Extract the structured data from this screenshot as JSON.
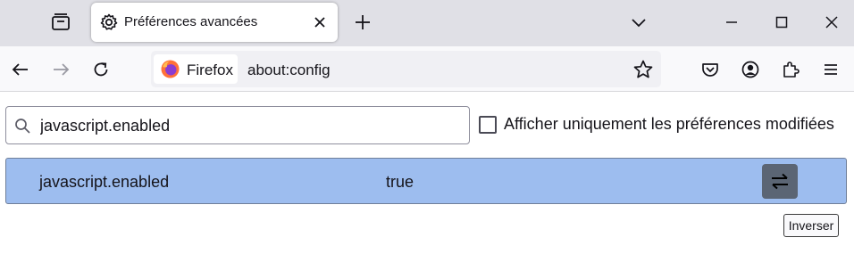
{
  "tab": {
    "title": "Préférences avancées"
  },
  "navbar": {
    "identity_label": "Firefox",
    "url": "about:config"
  },
  "content": {
    "search_value": "javascript.enabled",
    "modified_only_label": "Afficher uniquement les préférences modifiées",
    "modified_only_checked": false,
    "preference": {
      "name": "javascript.enabled",
      "value": "true"
    },
    "toggle_tooltip": "Inverser"
  },
  "icons": [
    "tab-overview-icon",
    "gear-icon",
    "close-icon",
    "plus-icon",
    "chevron-down-icon",
    "minimize-icon",
    "maximize-icon",
    "window-close-icon",
    "back-arrow-icon",
    "forward-arrow-icon",
    "reload-icon",
    "firefox-logo-icon",
    "star-icon",
    "pocket-icon",
    "account-icon",
    "extensions-icon",
    "hamburger-menu-icon",
    "search-icon",
    "toggle-arrows-icon"
  ],
  "colors": {
    "row_highlight": "#9dbdef",
    "toggle_button": "#5b6574",
    "tabstrip": "#e0e0e6"
  }
}
